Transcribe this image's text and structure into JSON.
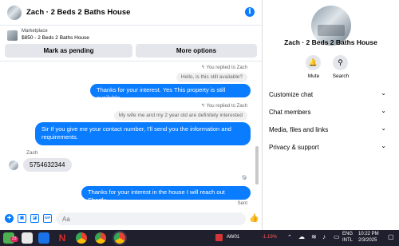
{
  "chat": {
    "title": "Zach · 2 Beds 2 Baths House",
    "info_glyph": "i",
    "marketplace": {
      "label": "Marketplace",
      "listing": "$850 - 2 Beds 2 Baths House"
    },
    "buttons": {
      "pending": "Mark as pending",
      "more": "More options"
    },
    "messages": {
      "replied1": "↰ You replied to Zach",
      "quoted1": "Hello, is this still available?",
      "msg1": "Thanks for your interest. Yes This property is still available.",
      "replied2": "↰ You replied to Zach",
      "quoted2": "My wife me and my 2 year old are definitely interested",
      "msg2": "Sir If you give me your contact number, I'll send you the information and requirements.",
      "sender": "Zach",
      "incoming": "5754632344",
      "msg3": "Thanks for your interest in the house I will reach out Shortly.",
      "status": "Sent"
    },
    "composer": {
      "placeholder": "Aa",
      "value": ""
    }
  },
  "profile": {
    "title": "Zach · 2 Beds 2 Baths House",
    "mute": "Mute",
    "search": "Search",
    "sections": [
      "Customize chat",
      "Chat members",
      "Media, files and links",
      "Privacy & support"
    ]
  },
  "taskbar": {
    "badge": "23",
    "stock": "AW01",
    "change": "-1.19%",
    "lang1": "ENG",
    "lang2": "INTL",
    "time": "10:22 PM",
    "date": "2/3/2025"
  },
  "colors": {
    "accent": "#0a7cff",
    "bubble_gray": "#e4e6eb",
    "taskbar": "#1f1f2e",
    "negative": "#ff5a5a"
  }
}
